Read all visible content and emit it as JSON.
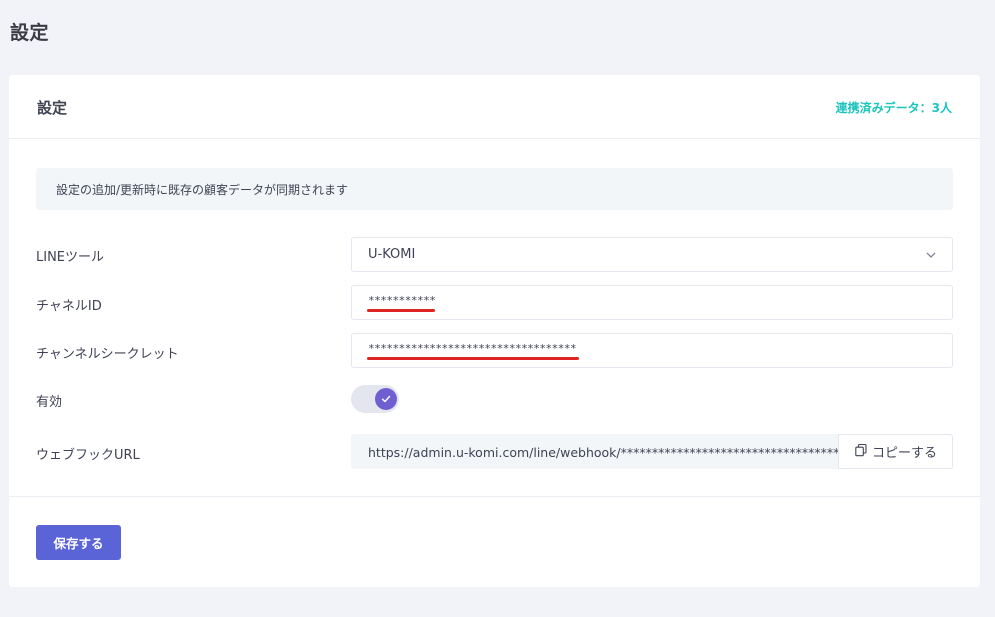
{
  "page": {
    "title": "設定"
  },
  "card": {
    "title": "設定",
    "sync_status": "連携済みデータ：3人",
    "notice": "設定の追加/更新時に既存の顧客データが同期されます"
  },
  "form": {
    "line_tool": {
      "label": "LINEツール",
      "value": "U-KOMI"
    },
    "channel_id": {
      "label": "チャネルID",
      "value": "***********"
    },
    "channel_secret": {
      "label": "チャンネルシークレット",
      "value": "**********************************"
    },
    "enabled": {
      "label": "有効",
      "on": true
    },
    "webhook_url": {
      "label": "ウェブフックURL",
      "value": "https://admin.u-komi.com/line/webhook/************************************",
      "copy_label": "コピーする"
    }
  },
  "footer": {
    "save_label": "保存する"
  },
  "colors": {
    "accent": "#5b64d6",
    "toggle_on": "#6f5fd0",
    "sync_status": "#1bc5bd",
    "redaction_mark": "#e02424"
  }
}
